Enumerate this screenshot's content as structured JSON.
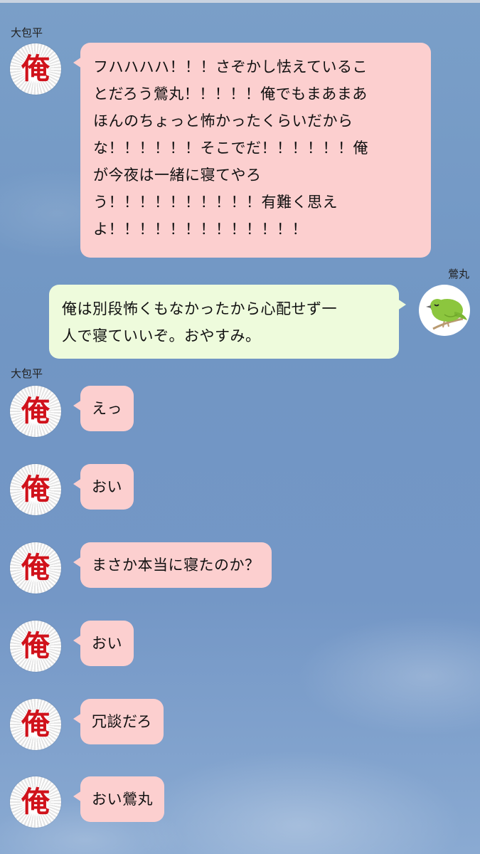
{
  "colors": {
    "sky": "#7a9fc8",
    "pink_bubble": "#fccfcf",
    "green_bubble": "#eefbdc",
    "avatar_glyph": "#d0121b"
  },
  "senders": {
    "left_name": "大包平",
    "right_name": "鶯丸",
    "left_avatar_glyph": "俺",
    "right_avatar_icon": "green-bird-icon"
  },
  "messages": [
    {
      "side": "left",
      "lines": [
        "フハハハハ！！！さぞかし怯えているこ",
        "とだろう鶯丸！！！！！俺でもまあまあ",
        "ほんのちょっと怖かったくらいだから",
        "な！！！！！！そこでだ！！！！！！俺",
        "が今夜は一緒に寝てやろ",
        "う！！！！！！！！！！有難く思え",
        "よ！！！！！！！！！！！！！"
      ]
    },
    {
      "side": "right",
      "lines": [
        "俺は別段怖くもなかったから心配せず一",
        "人で寝ていいぞ。おやすみ。"
      ]
    },
    {
      "side": "left",
      "text": "えっ"
    },
    {
      "side": "left",
      "text": "おい"
    },
    {
      "side": "left",
      "text": "まさか本当に寝たのか？"
    },
    {
      "side": "left",
      "text": "おい"
    },
    {
      "side": "left",
      "text": "冗談だろ"
    },
    {
      "side": "left",
      "text": "おい鶯丸"
    }
  ]
}
